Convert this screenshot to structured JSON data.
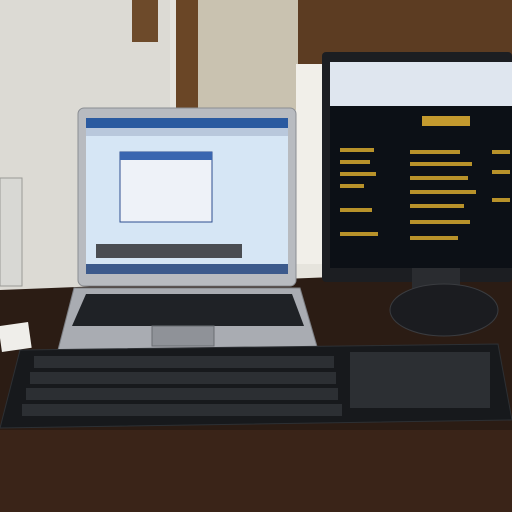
{
  "scene": {
    "monitor_brand": "",
    "notes": ""
  },
  "colors": {
    "wall": "#e8e6e0",
    "door": "#7a5a3a",
    "desk": "#2a1a12",
    "laptop_silver": "#b9bbbf",
    "monitor_screen": "#0c1016",
    "monitor_accent": "#b8922a",
    "laptop_screen": "#cfe0f2"
  }
}
